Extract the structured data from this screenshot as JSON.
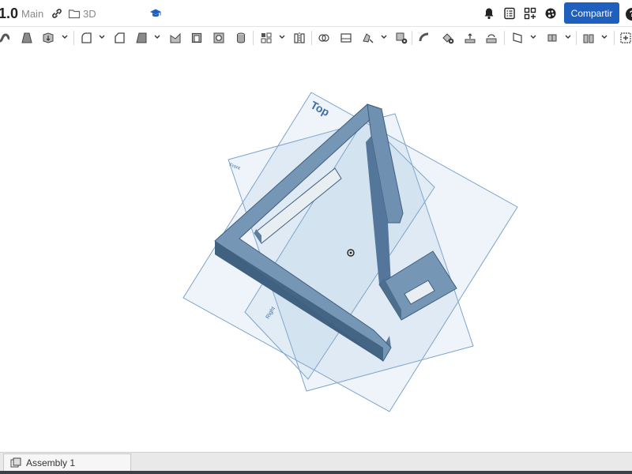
{
  "header": {
    "version": "1.0",
    "branch": "Main",
    "folder": "3D",
    "share_label": "Compartir",
    "help_label": "?"
  },
  "header_icons": [
    "link-icon",
    "folder-icon",
    "graduation-cap-icon",
    "notifications-icon",
    "feature-list-icon",
    "app-store-icon",
    "appearance-icon",
    "help-icon"
  ],
  "toolbar_tools": [
    "sweep-icon",
    "loft-icon",
    "thicken-icon",
    "fillet-icon",
    "chamfer-icon",
    "draft-icon",
    "rib-icon",
    "shell-icon",
    "hole-icon",
    "cylinder-icon",
    "pattern-icon",
    "mirror-icon",
    "boolean-icon",
    "split-icon",
    "transform-icon",
    "delete-part-icon",
    "modify-fillet-icon",
    "delete-face-icon",
    "move-face-icon",
    "replace-face-icon",
    "plane-icon",
    "mate-connector-icon",
    "sheet-metal-icon",
    "add-icon"
  ],
  "viewport": {
    "plane_label_top": "Top",
    "plane_label_right": "Right",
    "plane_label_front": "Front",
    "part_color": "#6b8fae",
    "plane_color": "#8fb2d6"
  },
  "tabs": [
    {
      "label": "Assembly 1"
    }
  ]
}
